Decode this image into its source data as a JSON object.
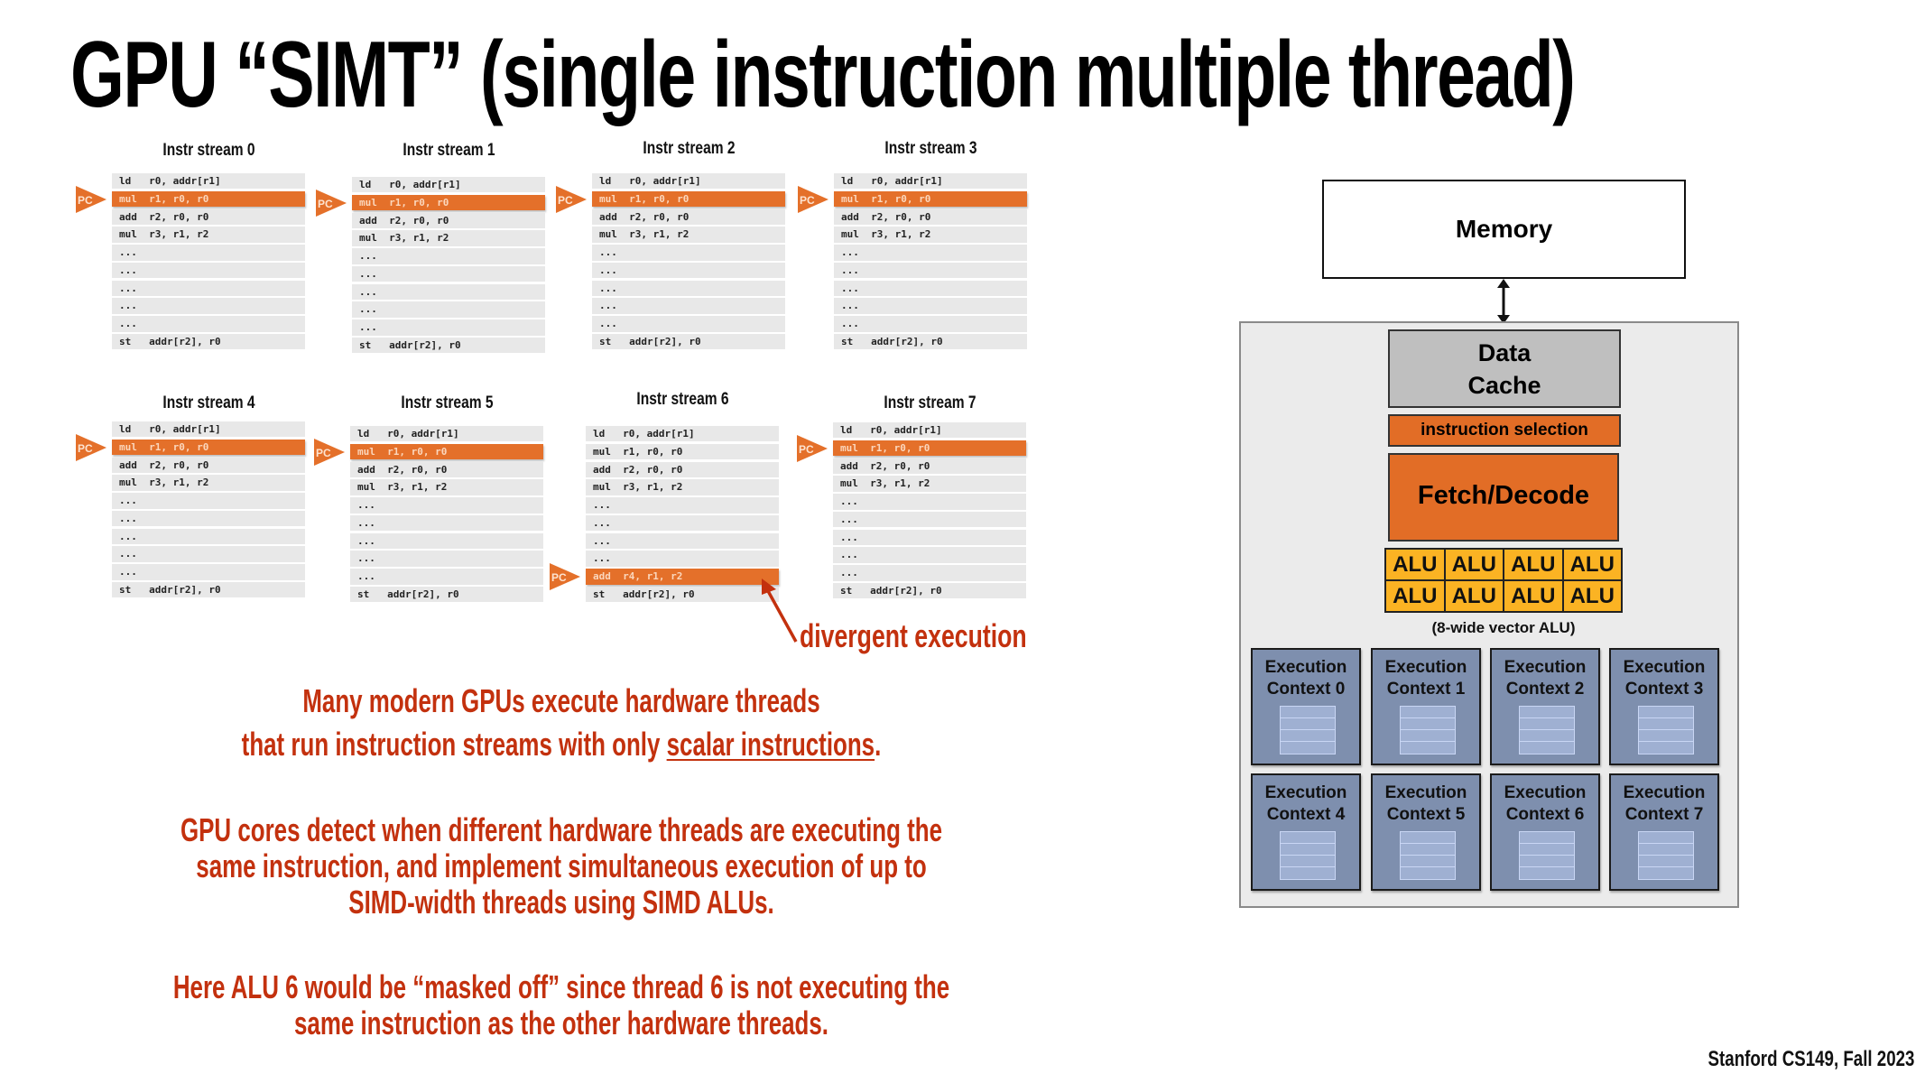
{
  "title": "GPU “SIMT”  (single instruction multiple thread)",
  "colors": {
    "accent_orange": "#e4702a",
    "alu_yellow": "#fbb323",
    "text_red": "#c3310e",
    "context_blue": "#7e8fae"
  },
  "pc_label": "PC",
  "streams": [
    {
      "title": "Instr stream 0",
      "pc_row": 1,
      "rows": [
        "ld   r0, addr[r1]",
        "mul  r1, r0, r0",
        "add  r2, r0, r0",
        "mul  r3, r1, r2",
        "...",
        "...",
        "...",
        "...",
        "...",
        "st   addr[r2], r0"
      ]
    },
    {
      "title": "Instr stream 1",
      "pc_row": 1,
      "rows": [
        "ld   r0, addr[r1]",
        "mul  r1, r0, r0",
        "add  r2, r0, r0",
        "mul  r3, r1, r2",
        "...",
        "...",
        "...",
        "...",
        "...",
        "st   addr[r2], r0"
      ]
    },
    {
      "title": "Instr stream 2",
      "pc_row": 1,
      "rows": [
        "ld   r0, addr[r1]",
        "mul  r1, r0, r0",
        "add  r2, r0, r0",
        "mul  r3, r1, r2",
        "...",
        "...",
        "...",
        "...",
        "...",
        "st   addr[r2], r0"
      ]
    },
    {
      "title": "Instr stream 3",
      "pc_row": 1,
      "rows": [
        "ld   r0, addr[r1]",
        "mul  r1, r0, r0",
        "add  r2, r0, r0",
        "mul  r3, r1, r2",
        "...",
        "...",
        "...",
        "...",
        "...",
        "st   addr[r2], r0"
      ]
    },
    {
      "title": "Instr stream 4",
      "pc_row": 1,
      "rows": [
        "ld   r0, addr[r1]",
        "mul  r1, r0, r0",
        "add  r2, r0, r0",
        "mul  r3, r1, r2",
        "...",
        "...",
        "...",
        "...",
        "...",
        "st   addr[r2], r0"
      ]
    },
    {
      "title": "Instr stream 5",
      "pc_row": 1,
      "rows": [
        "ld   r0, addr[r1]",
        "mul  r1, r0, r0",
        "add  r2, r0, r0",
        "mul  r3, r1, r2",
        "...",
        "...",
        "...",
        "...",
        "...",
        "st   addr[r2], r0"
      ]
    },
    {
      "title": "Instr stream 6",
      "pc_row": 8,
      "rows": [
        "ld   r0, addr[r1]",
        "mul  r1, r0, r0",
        "add  r2, r0, r0",
        "mul  r3, r1, r2",
        "...",
        "...",
        "...",
        "...",
        "add  r4, r1, r2",
        "st   addr[r2], r0"
      ]
    },
    {
      "title": "Instr stream 7",
      "pc_row": 1,
      "rows": [
        "ld   r0, addr[r1]",
        "mul  r1, r0, r0",
        "add  r2, r0, r0",
        "mul  r3, r1, r2",
        "...",
        "...",
        "...",
        "...",
        "...",
        "st   addr[r2], r0"
      ]
    }
  ],
  "divergent_label": "divergent execution",
  "paragraphs": {
    "p1_line1": "Many modern GPUs execute hardware threads",
    "p1_line2_prefix": "that run instruction streams with only ",
    "p1_line2_underlined": "scalar instructions",
    "p1_line2_suffix": ".",
    "p2_line1": "GPU cores detect when different hardware threads are executing the",
    "p2_line2": "same instruction, and implement simultaneous execution of up to",
    "p2_line3": "SIMD-width threads using SIMD ALUs.",
    "p3_line1": "Here ALU 6 would be “masked off” since thread 6 is not executing the",
    "p3_line2": "same instruction as the other hardware threads."
  },
  "diagram": {
    "memory": "Memory",
    "data_cache_line1": "Data",
    "data_cache_line2": "Cache",
    "instruction_selection": "instruction selection",
    "fetch_decode": "Fetch/Decode",
    "alus": [
      "ALU",
      "ALU",
      "ALU",
      "ALU",
      "ALU",
      "ALU",
      "ALU",
      "ALU"
    ],
    "alu_caption": "(8-wide vector ALU)",
    "contexts": [
      {
        "line1": "Execution",
        "line2": "Context 0"
      },
      {
        "line1": "Execution",
        "line2": "Context 1"
      },
      {
        "line1": "Execution",
        "line2": "Context 2"
      },
      {
        "line1": "Execution",
        "line2": "Context 3"
      },
      {
        "line1": "Execution",
        "line2": "Context 4"
      },
      {
        "line1": "Execution",
        "line2": "Context 5"
      },
      {
        "line1": "Execution",
        "line2": "Context 6"
      },
      {
        "line1": "Execution",
        "line2": "Context 7"
      }
    ]
  },
  "footer": "Stanford CS149, Fall 2023"
}
